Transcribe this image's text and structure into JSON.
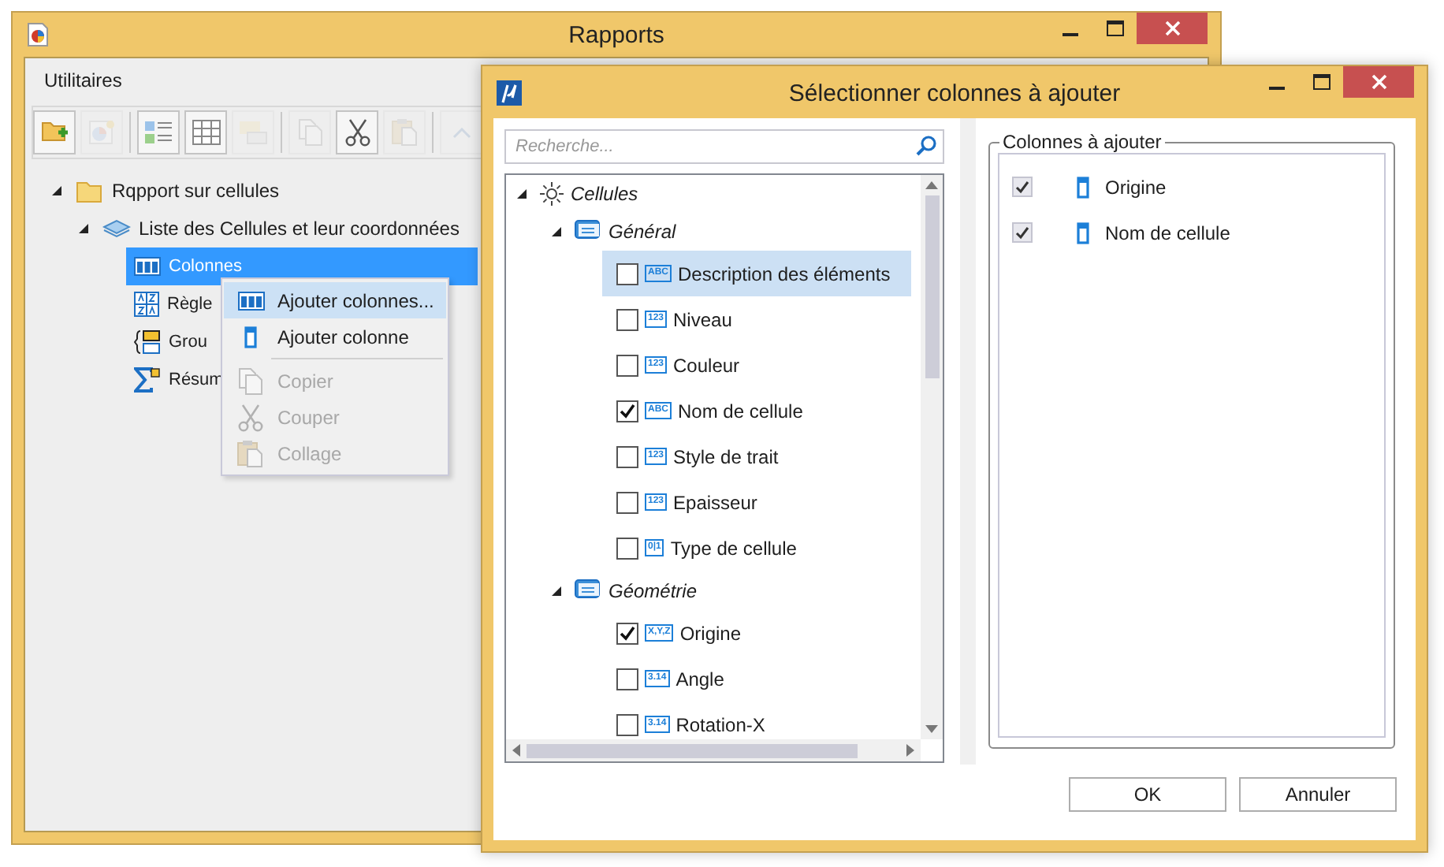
{
  "main_window": {
    "title": "Rapports",
    "menu": [
      "Utilitaires"
    ],
    "toolbar": [
      {
        "kind": "folder-add",
        "disabled": false
      },
      {
        "kind": "chart",
        "disabled": true
      },
      {
        "kind": "separator"
      },
      {
        "kind": "list",
        "disabled": false
      },
      {
        "kind": "grid",
        "disabled": false
      },
      {
        "kind": "tag",
        "disabled": true
      },
      {
        "kind": "separator"
      },
      {
        "kind": "copy",
        "disabled": true
      },
      {
        "kind": "cut",
        "disabled": false
      },
      {
        "kind": "paste",
        "disabled": true
      },
      {
        "kind": "separator"
      },
      {
        "kind": "up",
        "disabled": true
      }
    ],
    "tree": [
      {
        "label": "Rqpport sur cellules",
        "expanded": true,
        "selected": false,
        "children": [
          {
            "label": "Liste des Cellules et leur coordonnées",
            "expanded": true,
            "selected": false,
            "children": [
              {
                "label": "Colonnes",
                "selected": true
              },
              {
                "label": "Règle",
                "selected": false
              },
              {
                "label": "Grou",
                "selected": false
              },
              {
                "label": "Résum",
                "selected": false
              }
            ]
          }
        ]
      }
    ]
  },
  "context_menu": {
    "items": [
      {
        "kind": "item",
        "label": "Ajouter colonnes...",
        "disabled": false,
        "selected": true
      },
      {
        "kind": "item",
        "label": "Ajouter colonne",
        "disabled": false,
        "selected": false
      },
      {
        "kind": "separator"
      },
      {
        "kind": "item",
        "label": "Copier",
        "disabled": true,
        "selected": false
      },
      {
        "kind": "item",
        "label": "Couper",
        "disabled": true,
        "selected": false
      },
      {
        "kind": "item",
        "label": "Collage",
        "disabled": true,
        "selected": false
      }
    ]
  },
  "dialog": {
    "title": "Sélectionner colonnes à ajouter",
    "search": {
      "placeholder": "Recherche..."
    },
    "tree": [
      {
        "label": "Cellules",
        "expanded": true,
        "children": [
          {
            "label": "Général",
            "expanded": true,
            "children": [
              {
                "label": "Description des éléments",
                "badge": "ABC",
                "checked": false,
                "selected": true
              },
              {
                "label": "Niveau",
                "badge": "123",
                "checked": false,
                "selected": false
              },
              {
                "label": "Couleur",
                "badge": "123",
                "checked": false,
                "selected": false
              },
              {
                "label": "Nom de cellule",
                "badge": "ABC",
                "checked": true,
                "selected": false
              },
              {
                "label": "Style de trait",
                "badge": "123",
                "checked": false,
                "selected": false
              },
              {
                "label": "Epaisseur",
                "badge": "123",
                "checked": false,
                "selected": false
              },
              {
                "label": "Type de cellule",
                "badge": "0|1",
                "checked": false,
                "selected": false
              }
            ]
          },
          {
            "label": "Géométrie",
            "expanded": true,
            "children": [
              {
                "label": "Origine",
                "badge": "X,Y,Z",
                "checked": true,
                "selected": false
              },
              {
                "label": "Angle",
                "badge": "3.14",
                "checked": false,
                "selected": false
              },
              {
                "label": "Rotation-X",
                "badge": "3.14",
                "checked": false,
                "selected": false
              }
            ]
          }
        ]
      }
    ],
    "selected_panel": {
      "legend": "Colonnes à ajouter",
      "items": [
        {
          "label": "Origine",
          "checked": true
        },
        {
          "label": "Nom de cellule",
          "checked": true
        }
      ]
    },
    "buttons": [
      "OK",
      "Annuler"
    ]
  }
}
